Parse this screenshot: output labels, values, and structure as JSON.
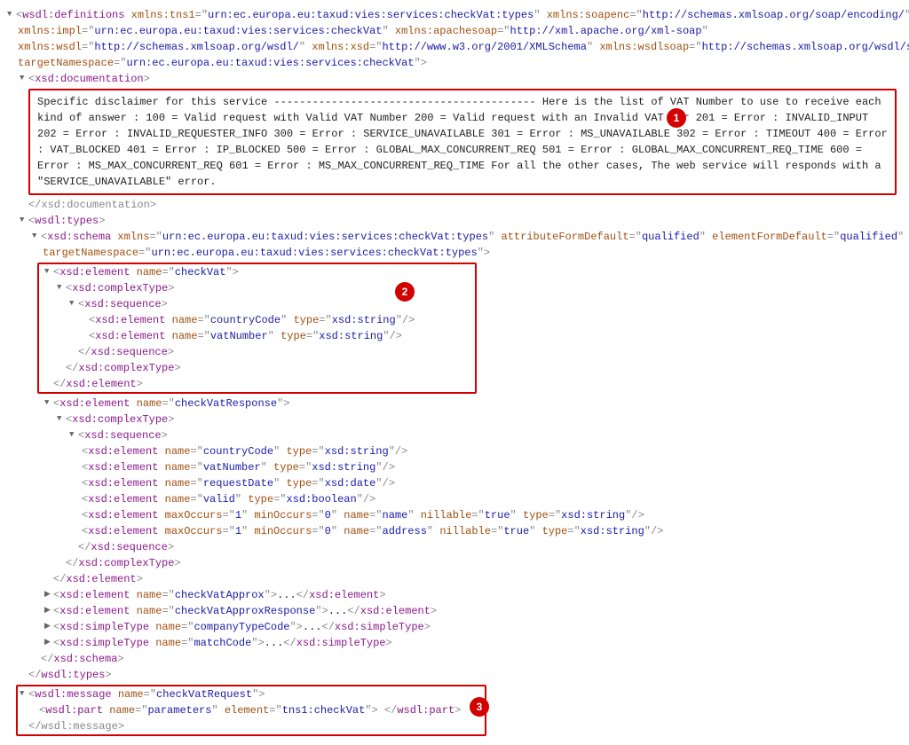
{
  "defs": {
    "open": "<wsdl:definitions",
    "a1": "xmlns:tns1",
    "v1": "urn:ec.europa.eu:taxud:vies:services:checkVat:types",
    "a2": "xmlns:soapenc",
    "v2": "http://schemas.xmlsoap.org/soap/encoding/",
    "a3": "xmlns:impl",
    "v3": "urn:ec.europa.eu:taxud:vies:services:checkVat",
    "a4": "xmlns:apachesoap",
    "v4": "http://xml.apache.org/xml-soap",
    "a5": "xmlns:wsdl",
    "v5": "http://schemas.xmlsoap.org/wsdl/",
    "a6": "xmlns:xsd",
    "v6": "http://www.w3.org/2001/XMLSchema",
    "a7": "xmlns:wsdlsoap",
    "v7": "http://schemas.xmlsoap.org/wsdl/soap/",
    "a8": "targetNamespace",
    "v8": "urn:ec.europa.eu:taxud:vies:services:checkVat"
  },
  "doc": {
    "open": "<xsd:documentation>",
    "close": "</xsd:documentation>",
    "text": "Specific disclaimer for this service ----------------------------------------- Here is the list of VAT Number to use to receive each kind of answer : 100 = Valid request with Valid VAT Number 200 = Valid request with an Invalid VAT    ber 201 = Error : INVALID_INPUT 202 = Error : INVALID_REQUESTER_INFO 300 = Error : SERVICE_UNAVAILABLE 301 = Error : MS_UNAVAILABLE 302 = Error : TIMEOUT 400 = Error : VAT_BLOCKED 401 = Error : IP_BLOCKED 500 = Error : GLOBAL_MAX_CONCURRENT_REQ 501 = Error : GLOBAL_MAX_CONCURRENT_REQ_TIME 600 = Error : MS_MAX_CONCURRENT_REQ 601 = Error : MS_MAX_CONCURRENT_REQ_TIME For all the other cases, The web service will responds with a \"SERVICE_UNAVAILABLE\" error."
  },
  "types": {
    "open": "<wsdl:types>",
    "close": "</wsdl:types>"
  },
  "schema": {
    "open": "<xsd:schema",
    "close": "</xsd:schema>",
    "a1": "xmlns",
    "v1": "urn:ec.europa.eu:taxud:vies:services:checkVat:types",
    "a2": "attributeFormDefault",
    "v2": "qualified",
    "a3": "elementFormDefault",
    "v3": "qualified",
    "a4": "targetNamespace",
    "v4": "urn:ec.europa.eu:taxud:vies:services:checkVat:types"
  },
  "checkVat": {
    "el": "xsd:element",
    "nameAttr": "name",
    "nameVal": "checkVat",
    "complex": "xsd:complexType",
    "seq": "xsd:sequence",
    "cc_name": "countryCode",
    "cc_type": "xsd:string",
    "vn_name": "vatNumber",
    "vn_type": "xsd:string",
    "typeAttr": "type"
  },
  "checkVatResp": {
    "nameVal": "checkVatResponse",
    "fields": {
      "cc": {
        "name": "countryCode",
        "type": "xsd:string"
      },
      "vn": {
        "name": "vatNumber",
        "type": "xsd:string"
      },
      "rd": {
        "name": "requestDate",
        "type": "xsd:date"
      },
      "va": {
        "name": "valid",
        "type": "xsd:boolean"
      },
      "nm": {
        "max": "1",
        "min": "0",
        "name": "name",
        "nillable": "true",
        "type": "xsd:string"
      },
      "ad": {
        "max": "1",
        "min": "0",
        "name": "address",
        "nillable": "true",
        "type": "xsd:string"
      }
    },
    "maxAttr": "maxOccurs",
    "minAttr": "minOccurs",
    "nilAttr": "nillable"
  },
  "collapsed": {
    "cva": "checkVatApprox",
    "cvar": "checkVatApproxResponse",
    "ctc": "companyTypeCode",
    "mc": "matchCode",
    "simple": "xsd:simpleType",
    "ellipsis": "..."
  },
  "msg": {
    "open": "wsdl:message",
    "nameVal": "checkVatRequest",
    "partOpen": "wsdl:part",
    "partName": "parameters",
    "elAttr": "element",
    "elVal": "tns1:checkVat",
    "close": "</wsdl:message>"
  },
  "badges": {
    "one": "1",
    "two": "2",
    "three": "3"
  }
}
